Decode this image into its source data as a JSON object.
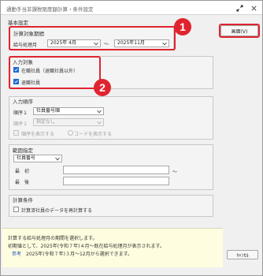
{
  "window": {
    "title": "通勤手当非課税限度額計算・条件設定"
  },
  "basic": {
    "heading": "基本設定"
  },
  "period": {
    "heading": "計算対象期間",
    "label": "給与処理月",
    "from": "2025年 4月",
    "separator": "～",
    "to": "2025年11月"
  },
  "print_button": "画面(V)",
  "badges": [
    "1",
    "2"
  ],
  "target": {
    "heading": "入力対象",
    "options": [
      {
        "label": "在職社員（退職社員以外）",
        "checked": true
      },
      {
        "label": "退職社員",
        "checked": true
      }
    ]
  },
  "order": {
    "heading": "入力順序",
    "order1_label": "順序１",
    "order1_value": "社員番号順",
    "order2_label": "順序２",
    "order2_value": "指定なし",
    "show_order_label": "順序を表示する",
    "show_code_label": "コードを表示する"
  },
  "range": {
    "heading": "範囲指定",
    "field": "社員番号",
    "from_label": "最　初",
    "to_label": "最　後",
    "separator": "～"
  },
  "calc": {
    "heading": "計算条件",
    "recalc_label": "計算済社員のデータを再計算する"
  },
  "info": {
    "line1": "計算する給与処理月の期間を選択します。",
    "line2": "初期値として、2025年(令和７年)４月～既在給与処理月が表示されます。",
    "ref_label": "参考",
    "line3": "2025年(令和７年)３月～12月から選択できます。"
  },
  "cancel_button": "ｷｬﾝｾﾙ",
  "colors": {
    "accent_red": "#e0242f",
    "checkbox_blue": "#1e6ad6",
    "info_bg": "#fffde0"
  },
  "icons": {
    "expand": "expand-icon",
    "close": "close-icon",
    "dropdown": "chevron-down-icon",
    "check": "checkmark-icon"
  }
}
